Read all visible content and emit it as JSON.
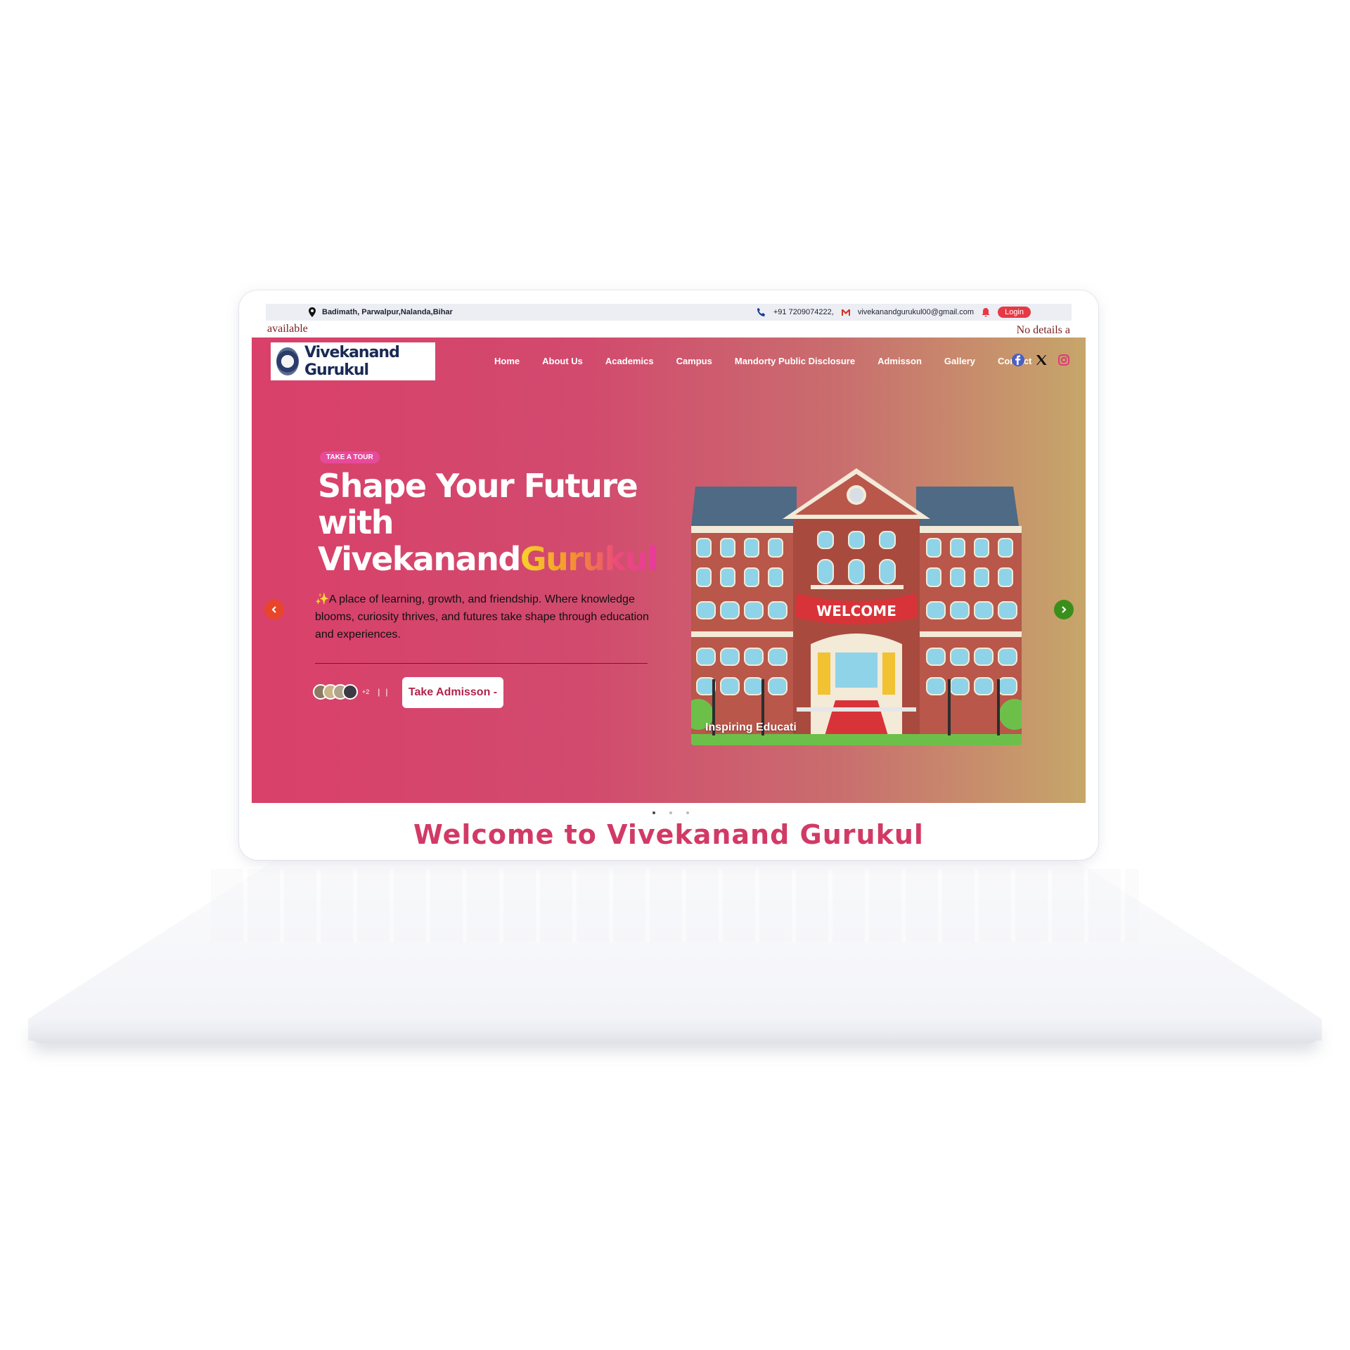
{
  "topbar": {
    "address": "Badimath, Parwalpur,Nalanda,Bihar",
    "phone": "+91 7209074222,",
    "email": "vivekanandgurukul00@gmail.com",
    "login_label": "Login"
  },
  "marquee": {
    "left_text": "available",
    "right_text": "No details a"
  },
  "header": {
    "logo_text": "Vivekanand Gurukul",
    "nav": [
      "Home",
      "About Us",
      "Academics",
      "Campus",
      "Mandorty Public Disclosure",
      "Admisson",
      "Gallery",
      "Contact"
    ],
    "social": [
      "facebook-icon",
      "x-icon",
      "instagram-icon"
    ]
  },
  "hero": {
    "badge": "TAKE A TOUR",
    "title_line1": "Shape Your Future",
    "title_line2": "with",
    "title_plain": "Vivekanand",
    "title_gradient": "Gurukul",
    "description": "✨A place of learning, growth, and friendship. Where knowledge blooms, curiosity thrives, and futures take shape through education and experiences.",
    "avatars_more": "+2",
    "cta_label": "Take Admisson -",
    "image_banner": "WELCOME",
    "image_caption": "Inspiring Educati"
  },
  "carousel": {
    "slides": 3,
    "active": 0
  },
  "section": {
    "welcome_title": "Welcome to Vivekanand Gurukul"
  },
  "colors": {
    "accent": "#d23a66",
    "gradient_start": "#d9406a",
    "gradient_end": "#c6a66a",
    "login": "#e63946"
  }
}
